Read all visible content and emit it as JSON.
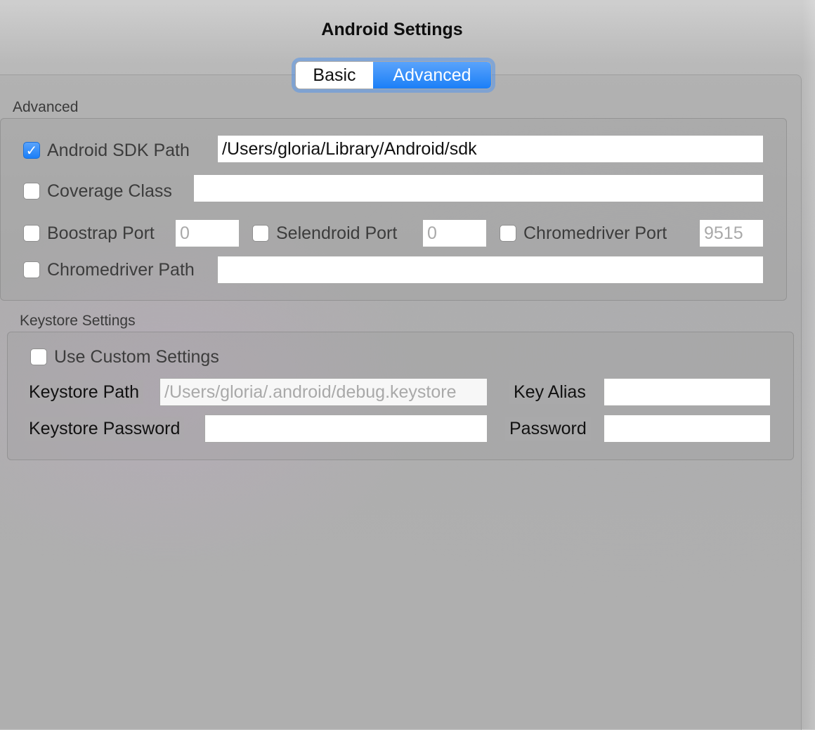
{
  "window": {
    "title": "Android Settings"
  },
  "tabs": {
    "basic": "Basic",
    "advanced": "Advanced",
    "selected": "Advanced"
  },
  "advanced_section": {
    "label": "Advanced",
    "sdk_path": {
      "label": "Android SDK Path",
      "checked": true,
      "value": "/Users/gloria/Library/Android/sdk"
    },
    "coverage_class": {
      "label": "Coverage Class",
      "checked": false,
      "value": ""
    },
    "bootstrap_port": {
      "label": "Boostrap Port",
      "checked": false,
      "placeholder": "0"
    },
    "selendroid_port": {
      "label": "Selendroid Port",
      "checked": false,
      "placeholder": "0"
    },
    "chromedriver_port": {
      "label": "Chromedriver Port",
      "checked": false,
      "placeholder": "9515"
    },
    "chromedriver_path": {
      "label": "Chromedriver Path",
      "checked": false,
      "value": ""
    }
  },
  "keystore_section": {
    "label": "Keystore Settings",
    "use_custom": {
      "label": "Use Custom Settings",
      "checked": false
    },
    "keystore_path": {
      "label": "Keystore Path",
      "placeholder": "/Users/gloria/.android/debug.keystore"
    },
    "key_alias": {
      "label": "Key Alias",
      "value": ""
    },
    "keystore_password": {
      "label": "Keystore Password",
      "value": ""
    },
    "password": {
      "label": "Password",
      "value": ""
    }
  },
  "colors": {
    "accent": "#1b7ff7",
    "background": "#b5b5b5"
  }
}
